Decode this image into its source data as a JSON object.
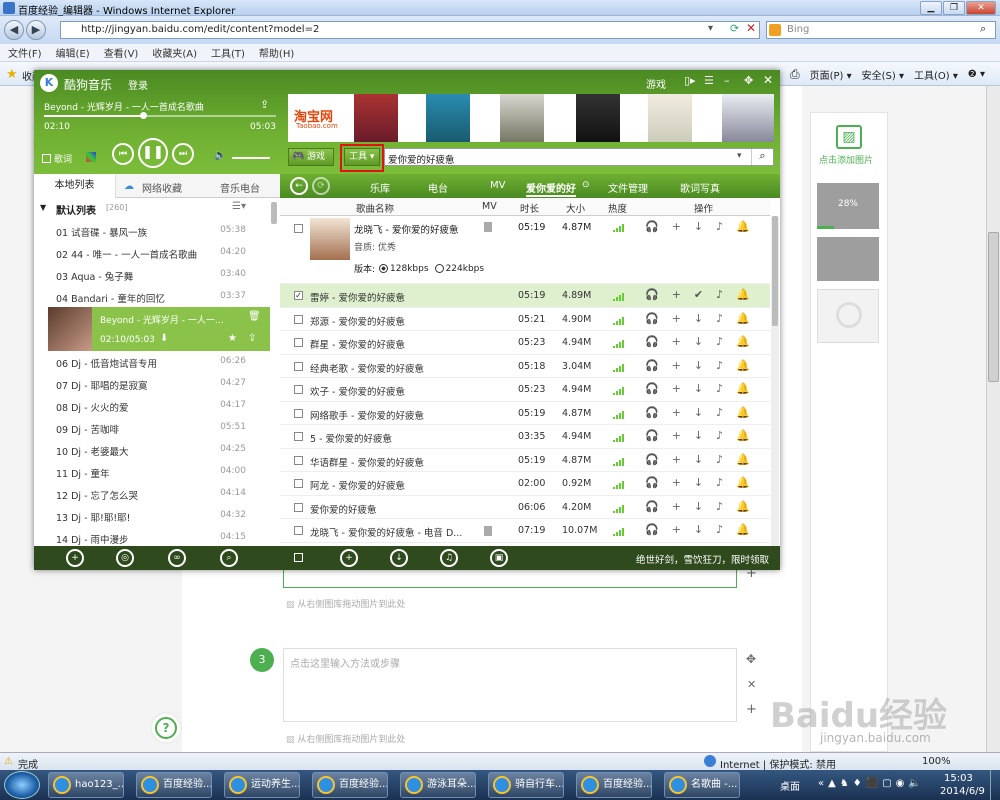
{
  "ie": {
    "title": "百度经验_编辑器 - Windows Internet Explorer",
    "address": "http://jingyan.baidu.com/edit/content?model=2",
    "search_placeholder": "Bing",
    "menu": [
      "文件(F)",
      "编辑(E)",
      "查看(V)",
      "收藏夹(A)",
      "工具(T)",
      "帮助(H)"
    ],
    "fav_label": "收藏",
    "cmd": [
      "页面(P) ▾",
      "安全(S) ▾",
      "工具(O) ▾",
      "❷ ▾"
    ],
    "status_left": "完成",
    "status_zone": "Internet | 保护模式: 禁用",
    "zoom": "100%"
  },
  "kugou": {
    "app_name": "酷狗音乐",
    "login": "登录",
    "now_playing": "Beyond - 光辉岁月 - 一人一首成名歌曲",
    "time_elapsed": "02:10",
    "time_total": "05:03",
    "lyrics_label": "歌词",
    "game_label": "游戏",
    "ad_brand": "淘宝网",
    "ad_brand_sub": "Taobao.com",
    "game_btn": "游戏",
    "tools_btn": "工具",
    "search_value": "爱你爱的好疲惫",
    "left_tabs": [
      "本地列表",
      "网络收藏",
      "音乐电台"
    ],
    "list_header": "默认列表",
    "list_count": "[260]",
    "local_list": [
      {
        "n": "01 试音碟 - 暴风一族",
        "t": "05:38"
      },
      {
        "n": "02 44 - 唯一 - 一人一首成名歌曲",
        "t": "04:20"
      },
      {
        "n": "03 Aqua - 兔子舞",
        "t": "03:40"
      },
      {
        "n": "04 Bandari - 童年的回忆",
        "t": "03:37"
      }
    ],
    "playing_item": {
      "n": "Beyond - 光辉岁月 - 一人一…",
      "t": "02:10/05:03"
    },
    "local_list2": [
      {
        "n": "06 Dj - 低音炮试音专用",
        "t": "06:26"
      },
      {
        "n": "07 Dj - 耶唱的是寂寞",
        "t": "04:27"
      },
      {
        "n": "08 Dj - 火火的爱",
        "t": "04:17"
      },
      {
        "n": "09 Dj - 苦咖啡",
        "t": "05:51"
      },
      {
        "n": "10 Dj - 老婆最大",
        "t": "04:25"
      },
      {
        "n": "11 Dj - 童年",
        "t": "04:00"
      },
      {
        "n": "12 Dj - 忘了怎么哭",
        "t": "04:14"
      },
      {
        "n": "13 Dj - 耶!耶!耶!",
        "t": "04:32"
      },
      {
        "n": "14 Dj - 雨中漫步",
        "t": "04:15"
      }
    ],
    "right_tabs": [
      "乐库",
      "电台",
      "MV",
      "爱你爱的好",
      "文件管理",
      "歌词写真"
    ],
    "cols": [
      "歌曲名称",
      "MV",
      "时长",
      "大小",
      "热度",
      "操作"
    ],
    "expanded": {
      "name": "龙晓飞 - 爱你爱的好疲惫",
      "dur": "05:19",
      "size": "4.87M",
      "quality": "音质: 优秀",
      "version_label": "版本:",
      "v1": "128kbps",
      "v2": "224kbps"
    },
    "songs": [
      {
        "name": "雷婷 - 爱你爱的好疲惫",
        "dur": "05:19",
        "size": "4.89M",
        "sel": true
      },
      {
        "name": "郑源 - 爱你爱的好疲惫",
        "dur": "05:21",
        "size": "4.90M"
      },
      {
        "name": "群星 - 爱你爱的好疲惫",
        "dur": "05:23",
        "size": "4.94M"
      },
      {
        "name": "经典老歌 - 爱你爱的好疲惫",
        "dur": "05:18",
        "size": "3.04M"
      },
      {
        "name": "欢子 - 爱你爱的好疲惫",
        "dur": "05:23",
        "size": "4.94M"
      },
      {
        "name": "网络歌手 - 爱你爱的好疲惫",
        "dur": "05:19",
        "size": "4.87M"
      },
      {
        "name": "5 - 爱你爱的好疲惫",
        "dur": "03:35",
        "size": "4.94M"
      },
      {
        "name": "华语群星 - 爱你爱的好疲惫",
        "dur": "05:19",
        "size": "4.87M"
      },
      {
        "name": "阿龙 - 爱你爱的好疲惫",
        "dur": "02:00",
        "size": "0.92M"
      },
      {
        "name": "爱你爱的好疲惫",
        "dur": "06:06",
        "size": "4.20M"
      },
      {
        "name": "龙晓飞 - 爱你爱的好疲惫 - 电音 D...",
        "dur": "07:19",
        "size": "10.07M"
      }
    ],
    "bottom_ad": "绝世好剑，雪饮狂刀，限时领取"
  },
  "editor": {
    "placeholder_step": "点击这里输入方法或步骤",
    "drag_hint": "从右侧图库拖动图片到此处",
    "step_num": "3",
    "add_image": "点击添加图片",
    "progress_text": "28%",
    "progress": 0.28
  },
  "taskbar": {
    "items": [
      "hao123_...",
      "百度经验...",
      "运动养生...",
      "百度经验...",
      "游泳耳朵...",
      "骑自行车...",
      "百度经验...",
      "名歌曲 -..."
    ],
    "desktop": "桌面",
    "time": "15:03",
    "date": "2014/6/9"
  },
  "watermark": "Baidu经验",
  "watermark_url": "jingyan.baidu.com"
}
